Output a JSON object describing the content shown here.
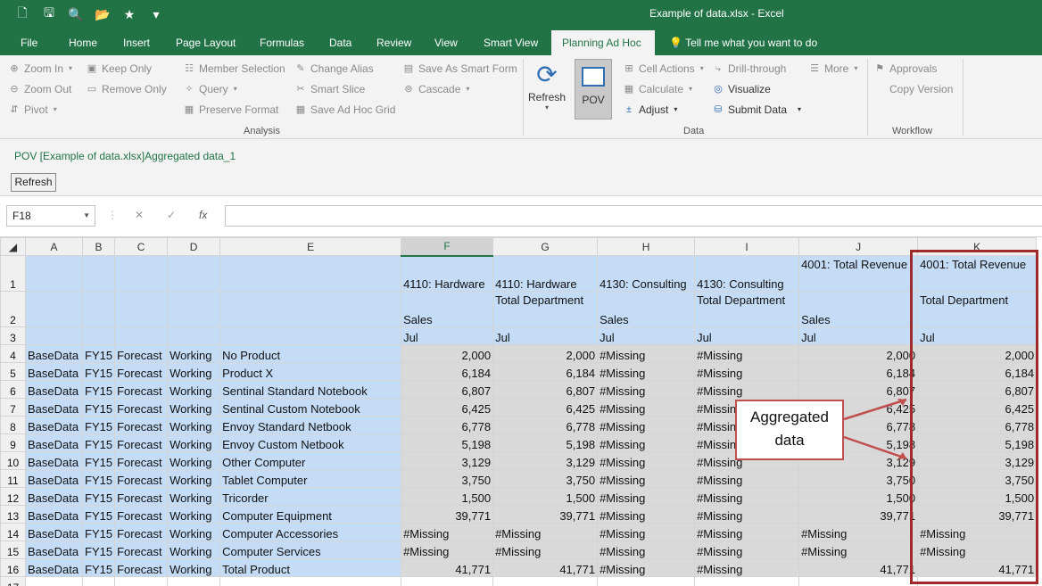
{
  "window": {
    "title": "Example of data.xlsx - Excel"
  },
  "qat": [
    {
      "icon": "new-file-icon",
      "glyph": "🗋"
    },
    {
      "icon": "save-icon",
      "glyph": "🖫"
    },
    {
      "icon": "print-preview-icon",
      "glyph": "🔍"
    },
    {
      "icon": "open-folder-icon",
      "glyph": "📂"
    },
    {
      "icon": "smart-view-icon",
      "glyph": "★"
    },
    {
      "icon": "customize-qat-icon",
      "glyph": "▾"
    }
  ],
  "tabs": [
    "File",
    "Home",
    "Insert",
    "Page Layout",
    "Formulas",
    "Data",
    "Review",
    "View",
    "Smart View",
    "Planning Ad Hoc"
  ],
  "tell_me": "Tell me what you want to do",
  "ribbon": {
    "analysis": {
      "zoom_in": "Zoom In",
      "keep_only": "Keep Only",
      "member_selection": "Member Selection",
      "change_alias": "Change Alias",
      "save_as_smart_form": "Save As Smart Form",
      "zoom_out": "Zoom Out",
      "remove_only": "Remove Only",
      "query": "Query",
      "smart_slice": "Smart Slice",
      "cascade": "Cascade",
      "pivot": "Pivot",
      "preserve_format": "Preserve Format",
      "save_ad_hoc_grid": "Save Ad Hoc Grid",
      "group_label": "Analysis"
    },
    "data": {
      "refresh": "Refresh",
      "pov": "POV",
      "cell_actions": "Cell Actions",
      "drill_through": "Drill-through",
      "more": "More",
      "calculate": "Calculate",
      "visualize": "Visualize",
      "adjust": "Adjust",
      "submit_data": "Submit Data",
      "group_label": "Data"
    },
    "workflow": {
      "approvals": "Approvals",
      "copy_version": "Copy Version",
      "group_label": "Workflow"
    }
  },
  "pov": {
    "label": "POV [Example of data.xlsx]Aggregated data_1",
    "refresh_button": "Refresh"
  },
  "formula_bar": {
    "name_box": "F18",
    "cancel": "✕",
    "enter": "✓",
    "fx": "fx",
    "value": ""
  },
  "sheet": {
    "columns": [
      "A",
      "B",
      "C",
      "D",
      "E",
      "F",
      "G",
      "H",
      "I",
      "J",
      "K"
    ],
    "selected_column": "F",
    "header_rows": {
      "row1": [
        "",
        "",
        "",
        "",
        "",
        "4110: Hardware",
        "4110: Hardware",
        "4130: Consulting",
        "4130: Consulting",
        "4001: Total Revenue",
        "4001: Total Revenue"
      ],
      "row2": [
        "",
        "",
        "",
        "",
        "",
        "Sales",
        "Total Department",
        "Sales",
        "Total Department",
        "Sales",
        "Total Department"
      ],
      "row3": [
        "",
        "",
        "",
        "",
        "",
        "Jul",
        "Jul",
        "Jul",
        "Jul",
        "Jul",
        "Jul"
      ]
    },
    "data_rows": [
      {
        "n": "4",
        "a": "BaseData",
        "b": "FY15",
        "c": "Forecast",
        "d": "Working",
        "e": "No Product",
        "indent": 1,
        "f": "2,000",
        "g": "2,000",
        "h": "#Missing",
        "i": "#Missing",
        "j": "2,000",
        "k": "2,000"
      },
      {
        "n": "5",
        "a": "BaseData",
        "b": "FY15",
        "c": "Forecast",
        "d": "Working",
        "e": "Product X",
        "indent": 2,
        "f": "6,184",
        "g": "6,184",
        "h": "#Missing",
        "i": "#Missing",
        "j": "6,184",
        "k": "6,184"
      },
      {
        "n": "6",
        "a": "BaseData",
        "b": "FY15",
        "c": "Forecast",
        "d": "Working",
        "e": "Sentinal Standard Notebook",
        "indent": 2,
        "f": "6,807",
        "g": "6,807",
        "h": "#Missing",
        "i": "#Missing",
        "j": "6,807",
        "k": "6,807"
      },
      {
        "n": "7",
        "a": "BaseData",
        "b": "FY15",
        "c": "Forecast",
        "d": "Working",
        "e": "Sentinal Custom Notebook",
        "indent": 2,
        "f": "6,425",
        "g": "6,425",
        "h": "#Missing",
        "i": "#Missing",
        "j": "6,425",
        "k": "6,425"
      },
      {
        "n": "8",
        "a": "BaseData",
        "b": "FY15",
        "c": "Forecast",
        "d": "Working",
        "e": "Envoy Standard Netbook",
        "indent": 2,
        "f": "6,778",
        "g": "6,778",
        "h": "#Missing",
        "i": "#Missing",
        "j": "6,778",
        "k": "6,778"
      },
      {
        "n": "9",
        "a": "BaseData",
        "b": "FY15",
        "c": "Forecast",
        "d": "Working",
        "e": "Envoy Custom Netbook",
        "indent": 2,
        "f": "5,198",
        "g": "5,198",
        "h": "#Missing",
        "i": "#Missing",
        "j": "5,198",
        "k": "5,198"
      },
      {
        "n": "10",
        "a": "BaseData",
        "b": "FY15",
        "c": "Forecast",
        "d": "Working",
        "e": "Other Computer",
        "indent": 2,
        "f": "3,129",
        "g": "3,129",
        "h": "#Missing",
        "i": "#Missing",
        "j": "3,129",
        "k": "3,129"
      },
      {
        "n": "11",
        "a": "BaseData",
        "b": "FY15",
        "c": "Forecast",
        "d": "Working",
        "e": "Tablet Computer",
        "indent": 2,
        "f": "3,750",
        "g": "3,750",
        "h": "#Missing",
        "i": "#Missing",
        "j": "3,750",
        "k": "3,750"
      },
      {
        "n": "12",
        "a": "BaseData",
        "b": "FY15",
        "c": "Forecast",
        "d": "Working",
        "e": "Tricorder",
        "indent": 2,
        "f": "1,500",
        "g": "1,500",
        "h": "#Missing",
        "i": "#Missing",
        "j": "1,500",
        "k": "1,500"
      },
      {
        "n": "13",
        "a": "BaseData",
        "b": "FY15",
        "c": "Forecast",
        "d": "Working",
        "e": "Computer Equipment",
        "indent": 1,
        "f": "39,771",
        "g": "39,771",
        "h": "#Missing",
        "i": "#Missing",
        "j": "39,771",
        "k": "39,771"
      },
      {
        "n": "14",
        "a": "BaseData",
        "b": "FY15",
        "c": "Forecast",
        "d": "Working",
        "e": "Computer Accessories",
        "indent": 1,
        "f": "#Missing",
        "g": "#Missing",
        "h": "#Missing",
        "i": "#Missing",
        "j": "#Missing",
        "k": "#Missing"
      },
      {
        "n": "15",
        "a": "BaseData",
        "b": "FY15",
        "c": "Forecast",
        "d": "Working",
        "e": "Computer Services",
        "indent": 1,
        "f": "#Missing",
        "g": "#Missing",
        "h": "#Missing",
        "i": "#Missing",
        "j": "#Missing",
        "k": "#Missing"
      },
      {
        "n": "16",
        "a": "BaseData",
        "b": "FY15",
        "c": "Forecast",
        "d": "Working",
        "e": "Total Product",
        "indent": 0,
        "f": "41,771",
        "g": "41,771",
        "h": "#Missing",
        "i": "#Missing",
        "j": "41,771",
        "k": "41,771"
      }
    ],
    "last_row": "17"
  },
  "callout": {
    "text": "Aggregated data"
  },
  "colors": {
    "excel_green": "#217346",
    "header_blue": "#c5dcf7",
    "data_gray": "#d9d9d9",
    "callout_red": "#c0504d"
  }
}
